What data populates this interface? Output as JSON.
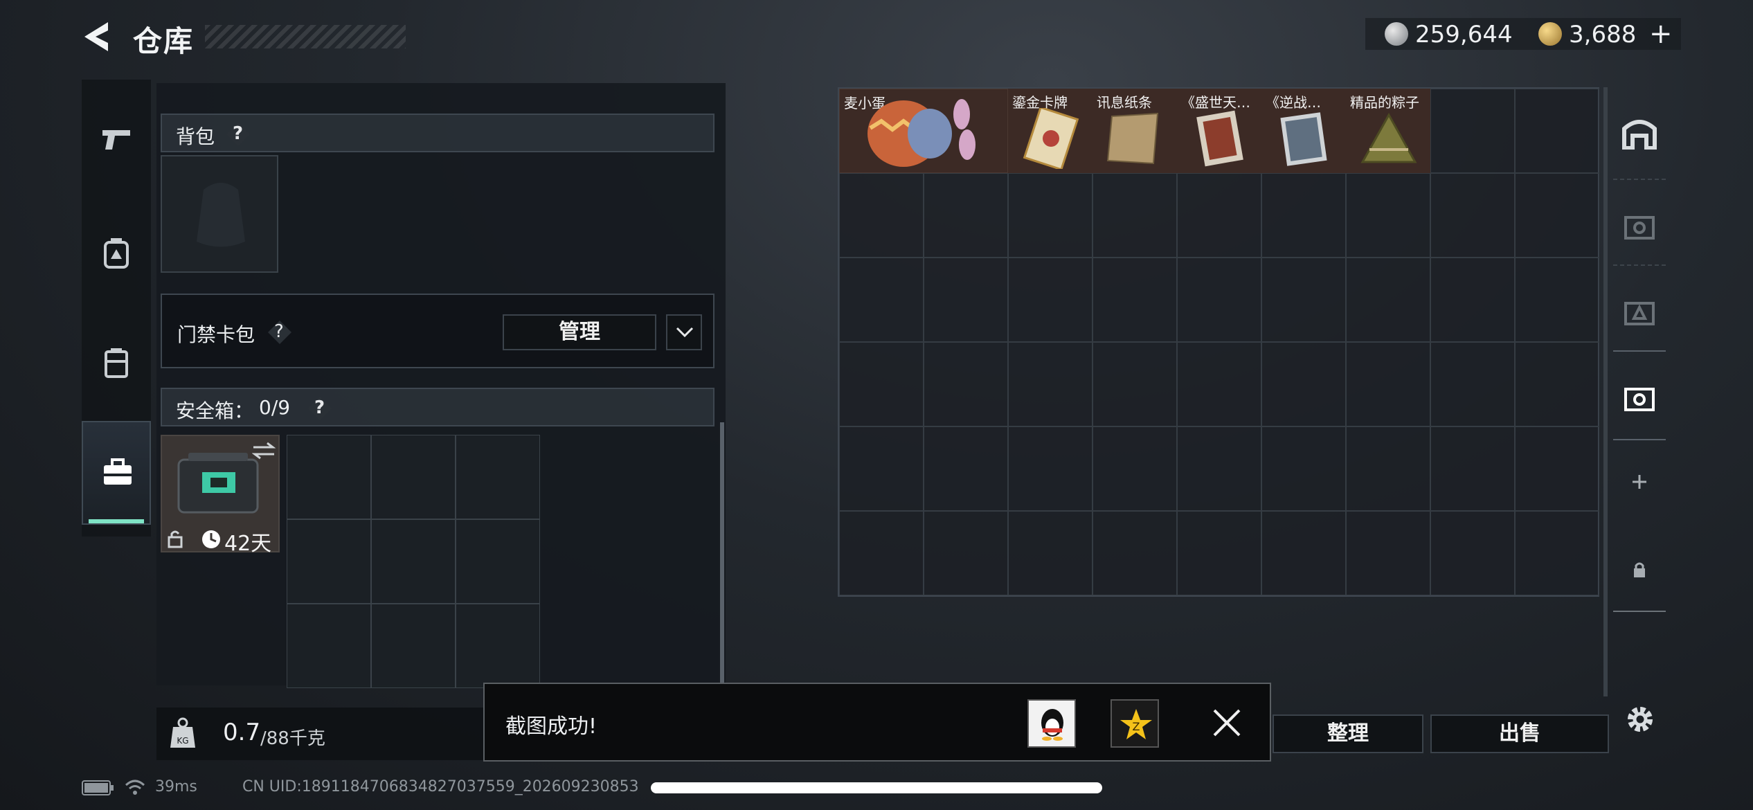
{
  "header": {
    "title": "仓库",
    "currency_silver": "259,644",
    "currency_gold": "3,688",
    "add_symbol": "+"
  },
  "left_nav": {
    "items": [
      "weapon-icon",
      "backpack-icon",
      "storage-icon",
      "toolbox-icon"
    ],
    "active_index": 3,
    "accent": "#7fe3c5"
  },
  "sections": {
    "backpack": {
      "label": "背包",
      "help": "?"
    },
    "keycard": {
      "label": "门禁卡包",
      "help": "?",
      "manage_button": "管理"
    },
    "safebox": {
      "label": "安全箱：",
      "count": "0/9",
      "help": "?",
      "item_duration": "42天"
    }
  },
  "weight": {
    "current": "0.7",
    "unit_total": "/88千克",
    "icon_label": "KG"
  },
  "stash": {
    "items": [
      {
        "label": "麦小蛋",
        "icon": "egg-bunny-icon"
      },
      {
        "label": "鎏金卡牌",
        "icon": "gold-card-icon"
      },
      {
        "label": "讯息纸条",
        "icon": "paper-note-icon"
      },
      {
        "label": "《盛世天…",
        "icon": "painting-icon"
      },
      {
        "label": "《逆战…",
        "icon": "artwork-icon"
      },
      {
        "label": "精品的粽子",
        "icon": "zongzi-icon"
      }
    ],
    "columns": 9,
    "rows": 6
  },
  "side_nav": [
    "home-icon",
    "level5-map-icon",
    "level4-map-icon",
    "level4-map-active-icon",
    "add-icon",
    "lock-icon"
  ],
  "buttons": {
    "sort": "整理",
    "sell": "出售"
  },
  "toast": {
    "message": "截图成功!"
  },
  "status": {
    "ping": "39ms",
    "uid": "CN UID:1891184706834827037559_202609230853"
  }
}
